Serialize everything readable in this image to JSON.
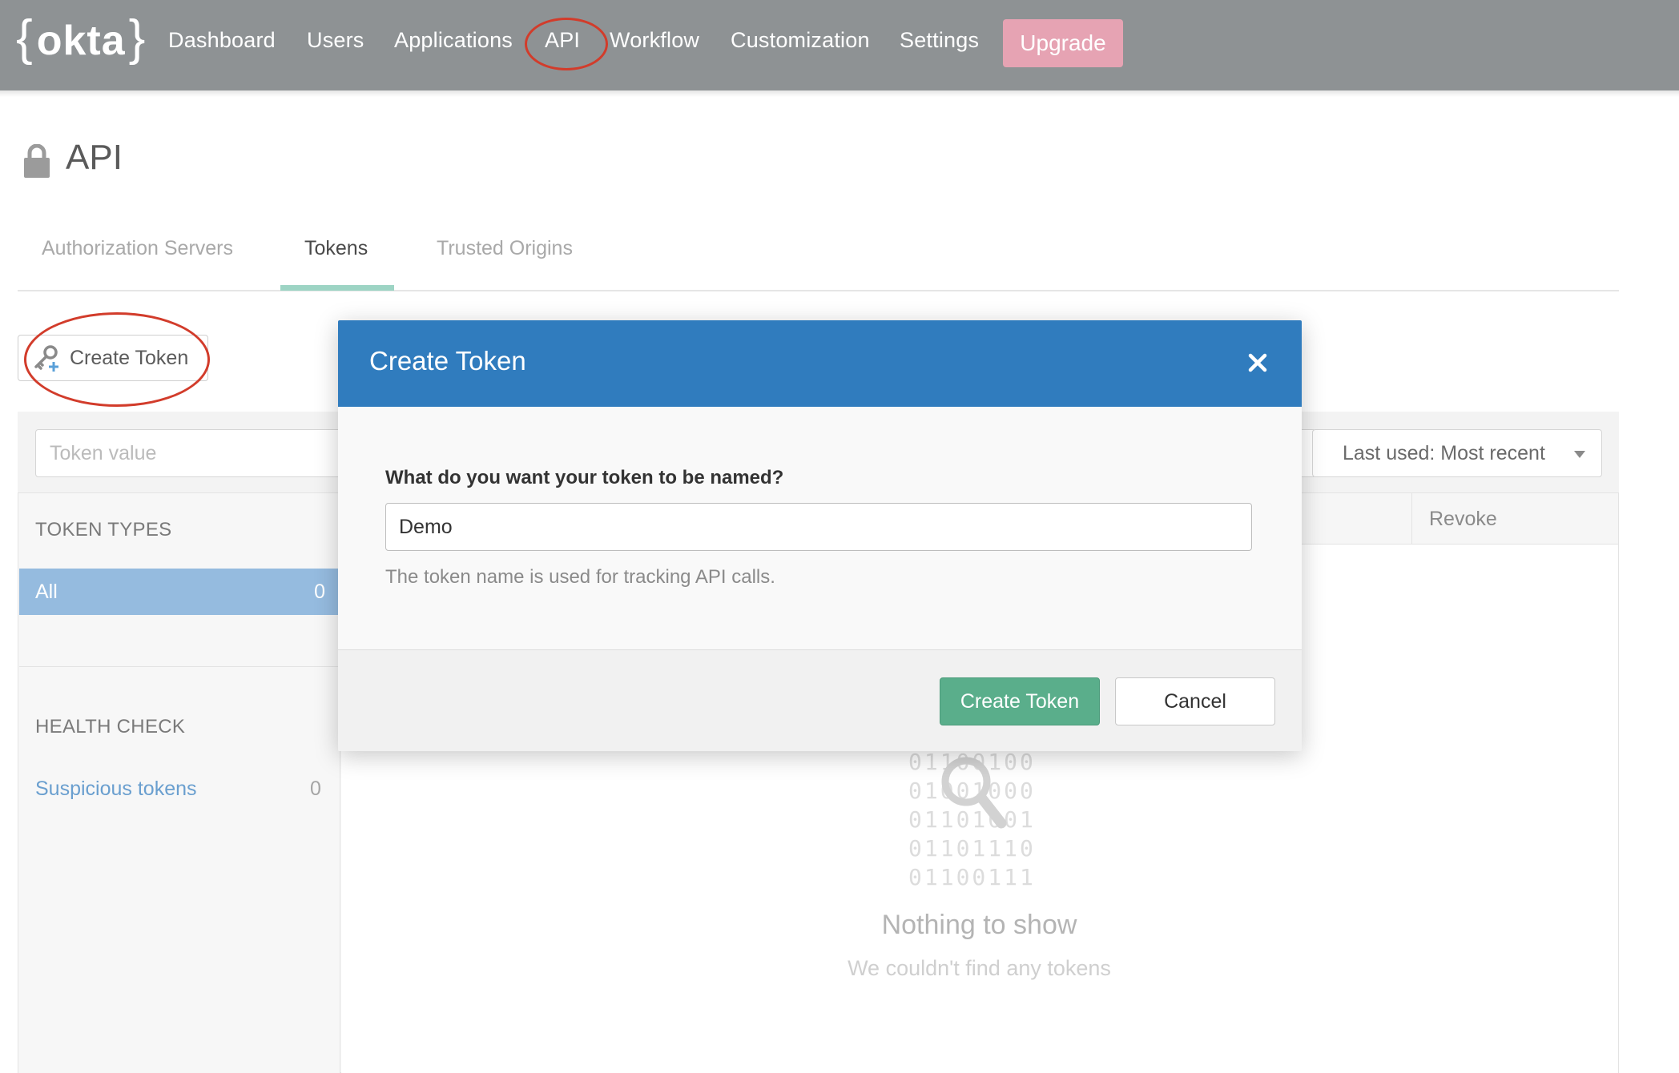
{
  "brand": {
    "logo_text": "okta"
  },
  "nav": {
    "items": [
      {
        "label": "Dashboard"
      },
      {
        "label": "Users"
      },
      {
        "label": "Applications"
      },
      {
        "label": "API"
      },
      {
        "label": "Workflow"
      },
      {
        "label": "Customization"
      },
      {
        "label": "Settings"
      }
    ],
    "upgrade_label": "Upgrade",
    "active": "API"
  },
  "page": {
    "title": "API",
    "icon": "lock-icon"
  },
  "tabs": [
    {
      "label": "Authorization Servers"
    },
    {
      "label": "Tokens"
    },
    {
      "label": "Trusted Origins"
    }
  ],
  "toolbar": {
    "create_token_label": "Create Token",
    "create_token_icon": "key-add-icon"
  },
  "filters": {
    "search_placeholder": "Token value",
    "sort_selected": "Last used: Most recent"
  },
  "sidebar": {
    "token_types_heading": "TOKEN TYPES",
    "all_label": "All",
    "all_count": "0",
    "health_check_heading": "HEALTH CHECK",
    "suspicious_label": "Suspicious tokens",
    "suspicious_count": "0"
  },
  "table": {
    "columns": [
      {
        "label": "Revoke"
      }
    ]
  },
  "empty_state": {
    "binary_lines": [
      "01100100",
      "01001000",
      "01101001",
      "01101110",
      "01100111"
    ],
    "title": "Nothing to show",
    "subtitle": "We couldn't find any tokens"
  },
  "modal": {
    "title": "Create Token",
    "field_label": "What do you want your token to be named?",
    "field_value": "Demo",
    "help_text": "The token name is used for tracking API calls.",
    "submit_label": "Create Token",
    "cancel_label": "Cancel"
  },
  "colors": {
    "topbar": "#8e9294",
    "upgrade": "#e6a3b3",
    "modal_header": "#307cbe",
    "primary_button": "#5aae8b",
    "sidebar_active": "#95bbdf",
    "annotation_ring": "#d23c2b"
  }
}
